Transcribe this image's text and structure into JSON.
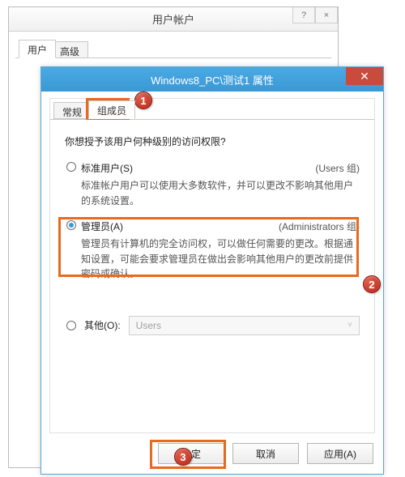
{
  "parent": {
    "title": "用户帐户",
    "tabs": [
      "用户",
      "高级"
    ]
  },
  "child": {
    "title": "Windows8_PC\\测试1 属性",
    "tabs": [
      "常规",
      "组成员"
    ],
    "prompt": "你想授予该用户何种级别的访问权限?",
    "options": {
      "standard": {
        "label": "标准用户(S)",
        "group": "(Users 组)",
        "desc": "标准帐户用户可以使用大多数软件，并可以更改不影响其他用户的系统设置。"
      },
      "admin": {
        "label": "管理员(A)",
        "group": "(Administrators 组)",
        "desc": "管理员有计算机的完全访问权，可以做任何需要的更改。根据通知设置，可能会要求管理员在做出会影响其他用户的更改前提供密码或确认。"
      },
      "other": {
        "label": "其他(O):",
        "combo": "Users"
      }
    },
    "buttons": {
      "ok": "确定",
      "cancel": "取消",
      "apply": "应用(A)"
    }
  },
  "callouts": {
    "one": "1",
    "two": "2",
    "three": "3"
  }
}
